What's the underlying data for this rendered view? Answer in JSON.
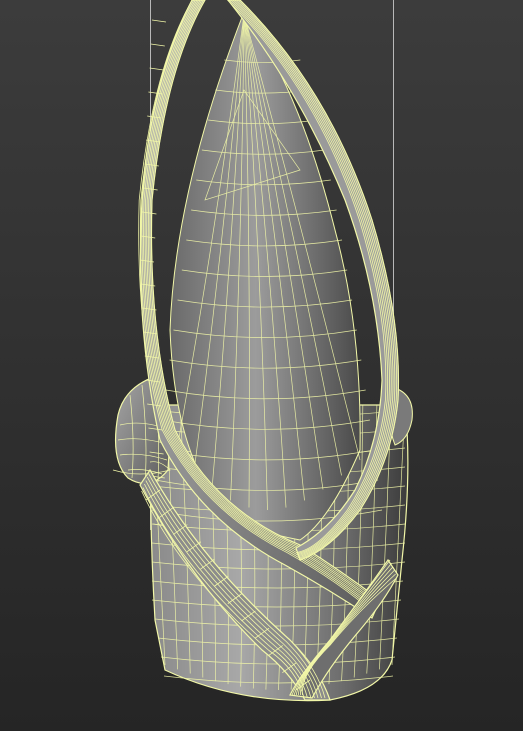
{
  "viewport": {
    "view": "perspective",
    "shading": "shaded-with-wireframe",
    "colors": {
      "background_top": "#3c3c3c",
      "background_bottom": "#252525",
      "wire": "#f2f7a8",
      "guide": "#d8d8d8",
      "shaded_light": "#b0b0b0",
      "shaded_dark": "#3a3a3a"
    },
    "object": {
      "name_icon": "wrapped-vase-mesh-icon",
      "selected": true
    }
  }
}
